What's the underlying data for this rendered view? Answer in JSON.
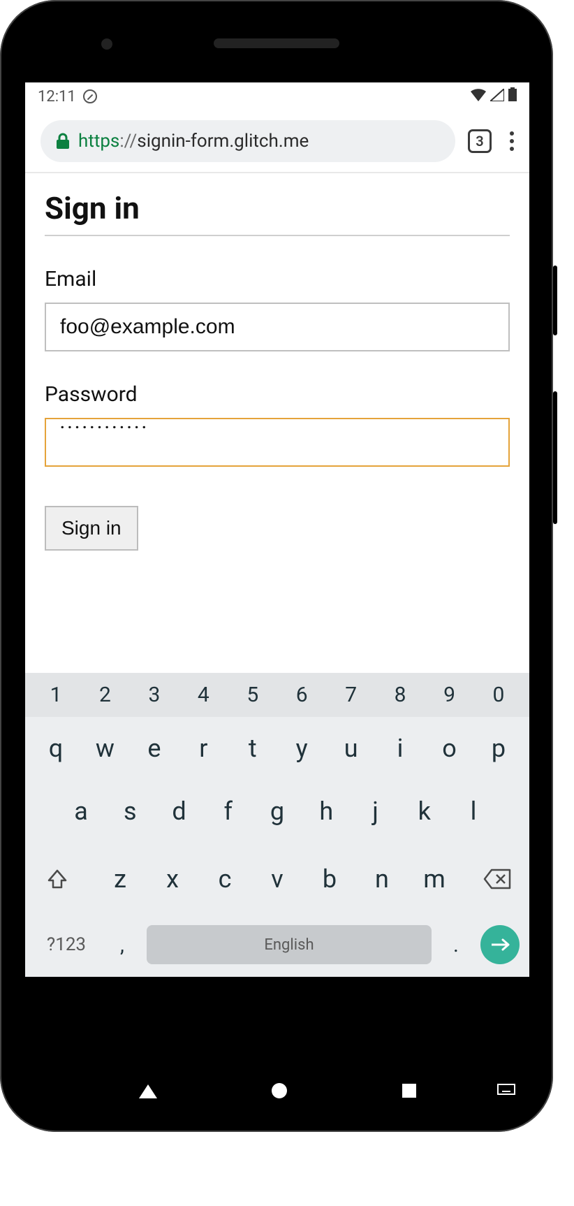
{
  "status_bar": {
    "time": "12:11"
  },
  "browser": {
    "url_scheme": "https",
    "url_sep": "://",
    "url_host": "signin-form.glitch.me",
    "tab_count": "3"
  },
  "page": {
    "title": "Sign in",
    "email_label": "Email",
    "email_value": "foo@example.com",
    "password_label": "Password",
    "password_value": "············",
    "signin_button": "Sign in"
  },
  "keyboard": {
    "numbers": [
      "1",
      "2",
      "3",
      "4",
      "5",
      "6",
      "7",
      "8",
      "9",
      "0"
    ],
    "row1": [
      "q",
      "w",
      "e",
      "r",
      "t",
      "y",
      "u",
      "i",
      "o",
      "p"
    ],
    "row2": [
      "a",
      "s",
      "d",
      "f",
      "g",
      "h",
      "j",
      "k",
      "l"
    ],
    "row3": [
      "z",
      "x",
      "c",
      "v",
      "b",
      "n",
      "m"
    ],
    "mode": "?123",
    "comma": ",",
    "period": ".",
    "space_label": "English"
  }
}
